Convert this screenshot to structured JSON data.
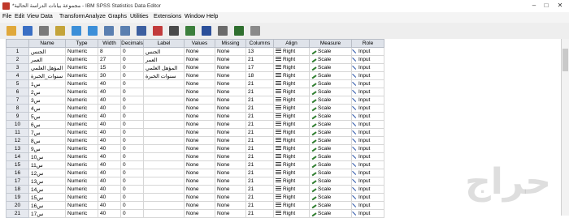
{
  "window": {
    "title": "*مجموعة بيانات الدراسة الحالية - IBM SPSS Statistics Data Editor"
  },
  "menu": [
    "File",
    "Edit",
    "View",
    "Data",
    "Transform",
    "Analyze",
    "Graphs",
    "Utilities",
    "Extensions",
    "Window",
    "Help"
  ],
  "toolbar_icons": [
    "open-icon",
    "save-icon",
    "print-icon",
    "recall-dialog-icon",
    "undo-icon",
    "redo-icon",
    "goto-case-icon",
    "goto-variable-icon",
    "variables-icon",
    "run-icon",
    "find-icon",
    "split-file-icon",
    "weight-cases-icon",
    "select-cases-icon",
    "value-labels-icon",
    "use-sets-icon"
  ],
  "columns": [
    "Name",
    "Type",
    "Width",
    "Decimals",
    "Label",
    "Values",
    "Missing",
    "Columns",
    "Align",
    "Measure",
    "Role"
  ],
  "rows": [
    [
      "1",
      "الجنس",
      "Numeric",
      "8",
      "0",
      "الجنس",
      "None",
      "None",
      "13",
      "Right",
      "Scale",
      "Input"
    ],
    [
      "2",
      "العمر",
      "Numeric",
      "27",
      "0",
      "العمر",
      "None",
      "None",
      "21",
      "Right",
      "Scale",
      "Input"
    ],
    [
      "3",
      "المؤهل العلمي",
      "Numeric",
      "15",
      "0",
      "المؤهل العلمي",
      "None",
      "None",
      "17",
      "Right",
      "Scale",
      "Input"
    ],
    [
      "4",
      "سنوات_الخبرة",
      "Numeric",
      "30",
      "0",
      "سنوات الخبرة",
      "None",
      "None",
      "18",
      "Right",
      "Scale",
      "Input"
    ],
    [
      "5",
      "س1",
      "Numeric",
      "40",
      "0",
      "",
      "None",
      "None",
      "21",
      "Right",
      "Scale",
      "Input"
    ],
    [
      "6",
      "س2",
      "Numeric",
      "40",
      "0",
      "",
      "None",
      "None",
      "21",
      "Right",
      "Scale",
      "Input"
    ],
    [
      "7",
      "س3",
      "Numeric",
      "40",
      "0",
      "",
      "None",
      "None",
      "21",
      "Right",
      "Scale",
      "Input"
    ],
    [
      "8",
      "س4",
      "Numeric",
      "40",
      "0",
      "",
      "None",
      "None",
      "21",
      "Right",
      "Scale",
      "Input"
    ],
    [
      "9",
      "س5",
      "Numeric",
      "40",
      "0",
      "",
      "None",
      "None",
      "21",
      "Right",
      "Scale",
      "Input"
    ],
    [
      "10",
      "س6",
      "Numeric",
      "40",
      "0",
      "",
      "None",
      "None",
      "21",
      "Right",
      "Scale",
      "Input"
    ],
    [
      "11",
      "س7",
      "Numeric",
      "40",
      "0",
      "",
      "None",
      "None",
      "21",
      "Right",
      "Scale",
      "Input"
    ],
    [
      "12",
      "س8",
      "Numeric",
      "40",
      "0",
      "",
      "None",
      "None",
      "21",
      "Right",
      "Scale",
      "Input"
    ],
    [
      "13",
      "س9",
      "Numeric",
      "40",
      "0",
      "",
      "None",
      "None",
      "21",
      "Right",
      "Scale",
      "Input"
    ],
    [
      "14",
      "س10",
      "Numeric",
      "40",
      "0",
      "",
      "None",
      "None",
      "21",
      "Right",
      "Scale",
      "Input"
    ],
    [
      "15",
      "س11",
      "Numeric",
      "40",
      "0",
      "",
      "None",
      "None",
      "21",
      "Right",
      "Scale",
      "Input"
    ],
    [
      "16",
      "س12",
      "Numeric",
      "40",
      "0",
      "",
      "None",
      "None",
      "21",
      "Right",
      "Scale",
      "Input"
    ],
    [
      "17",
      "س13",
      "Numeric",
      "40",
      "0",
      "",
      "None",
      "None",
      "21",
      "Right",
      "Scale",
      "Input"
    ],
    [
      "18",
      "س14",
      "Numeric",
      "40",
      "0",
      "",
      "None",
      "None",
      "21",
      "Right",
      "Scale",
      "Input"
    ],
    [
      "19",
      "س15",
      "Numeric",
      "40",
      "0",
      "",
      "None",
      "None",
      "21",
      "Right",
      "Scale",
      "Input"
    ],
    [
      "20",
      "س16",
      "Numeric",
      "40",
      "0",
      "",
      "None",
      "None",
      "21",
      "Right",
      "Scale",
      "Input"
    ],
    [
      "21",
      "س17",
      "Numeric",
      "40",
      "0",
      "",
      "None",
      "None",
      "21",
      "Right",
      "Scale",
      "Input"
    ]
  ],
  "watermark": "حراج",
  "colors": {
    "header_bg": "#dfe3ea",
    "rownum_bg": "#e6e9ef",
    "scale_green": "#2f7d2f",
    "input_blue": "#2b54a8"
  }
}
